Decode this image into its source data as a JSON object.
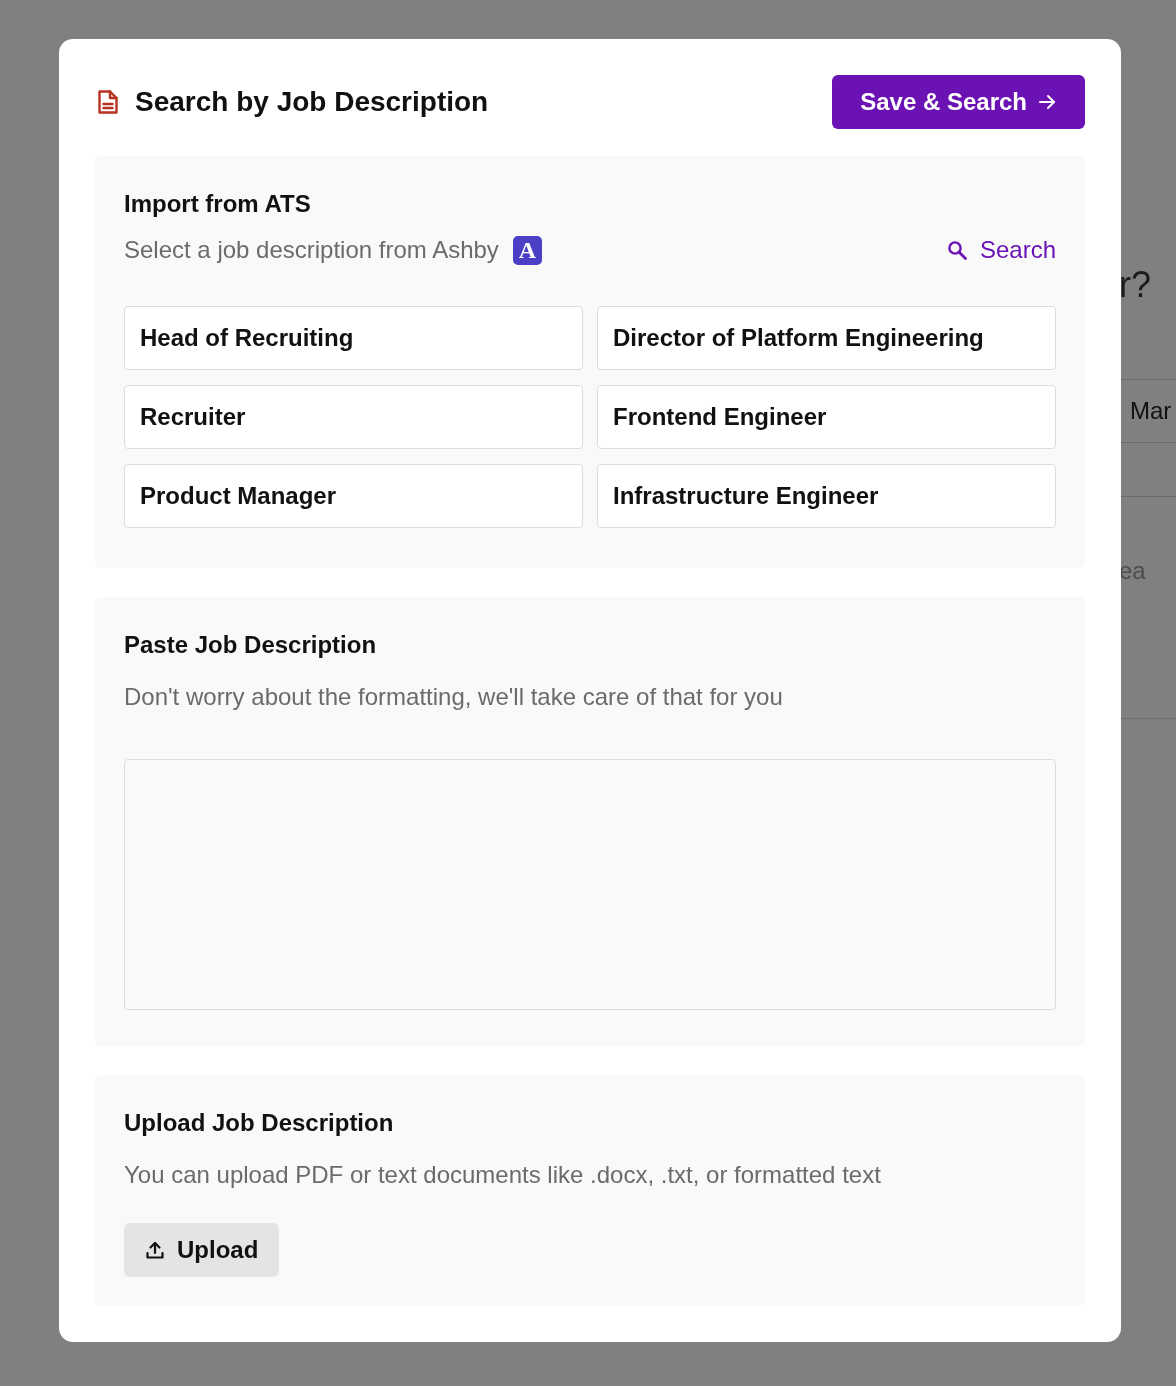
{
  "background": {
    "heading": "r?",
    "row_text": "Mar",
    "body_text": "ea"
  },
  "dialog": {
    "title": "Search by Job Description",
    "primary_button": "Save & Search"
  },
  "sections": [
    {
      "kind": "ats",
      "title": "Import from ATS",
      "subtitle": "Select a job description from Ashby",
      "logo_letter": "A",
      "search_link": "Search",
      "jobs": [
        {
          "label": "Head of Recruiting",
          "selected": false
        },
        {
          "label": "Director of Platform Engineering",
          "selected": false
        },
        {
          "label": "Recruiter",
          "selected": false
        },
        {
          "label": "Frontend Engineer",
          "selected": false
        },
        {
          "label": "Product Manager",
          "selected": false
        },
        {
          "label": "Infrastructure Engineer",
          "selected": false
        }
      ]
    },
    {
      "kind": "paste",
      "title": "Paste Job Description",
      "subtitle": "Don't worry about the formatting, we'll take care of that for you"
    },
    {
      "kind": "upload",
      "title": "Upload Job Description",
      "subtitle": "You can upload PDF or text documents like .docx, .txt, or formatted text",
      "button": "Upload"
    }
  ]
}
